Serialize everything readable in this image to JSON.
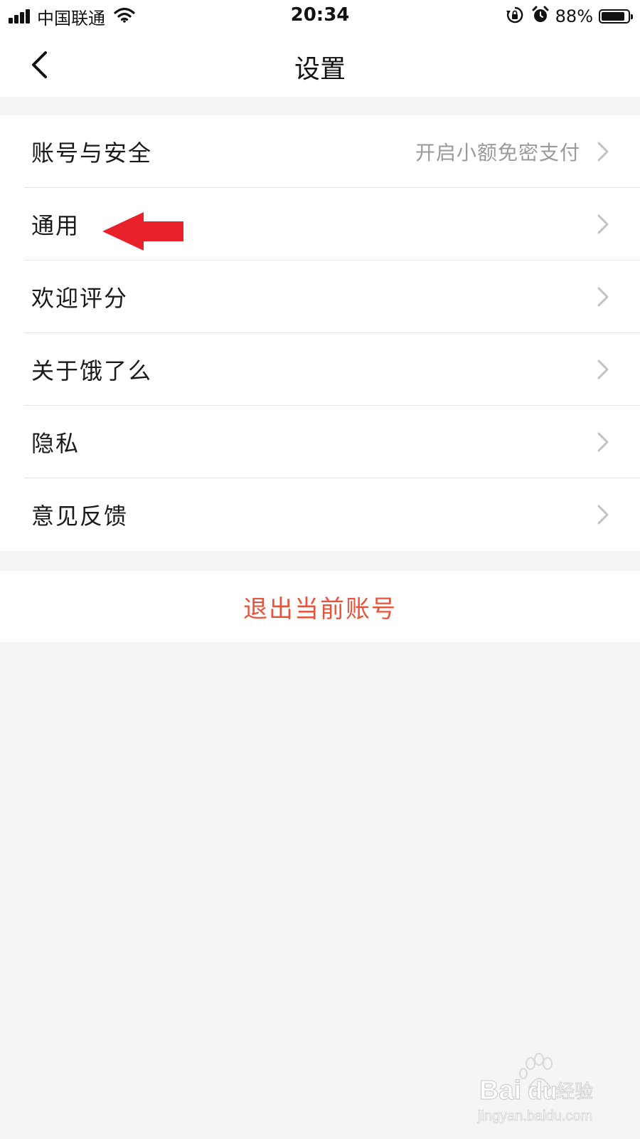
{
  "status_bar": {
    "carrier": "中国联通",
    "time": "20:34",
    "battery_percent": "88%",
    "battery_level": 0.88,
    "icons": [
      "signal-icon",
      "wifi-icon",
      "rotation-lock-icon",
      "alarm-icon",
      "battery-icon"
    ]
  },
  "nav": {
    "title": "设置",
    "back_icon": "chevron-left-icon"
  },
  "menu": {
    "items": [
      {
        "label": "账号与安全",
        "detail": "开启小额免密支付"
      },
      {
        "label": "通用",
        "detail": ""
      },
      {
        "label": "欢迎评分",
        "detail": ""
      },
      {
        "label": "关于饿了么",
        "detail": ""
      },
      {
        "label": "隐私",
        "detail": ""
      },
      {
        "label": "意见反馈",
        "detail": ""
      }
    ]
  },
  "logout": {
    "label": "退出当前账号"
  },
  "colors": {
    "background": "#f5f5f5",
    "card": "#ffffff",
    "logout": "#e8533a",
    "annotation_arrow": "#e8212b",
    "secondary_text": "#9a9a9a"
  },
  "watermark": {
    "brand": "Bai",
    "brand_suffix": "du",
    "product": "经验",
    "url": "jingyan.baidu.com"
  }
}
